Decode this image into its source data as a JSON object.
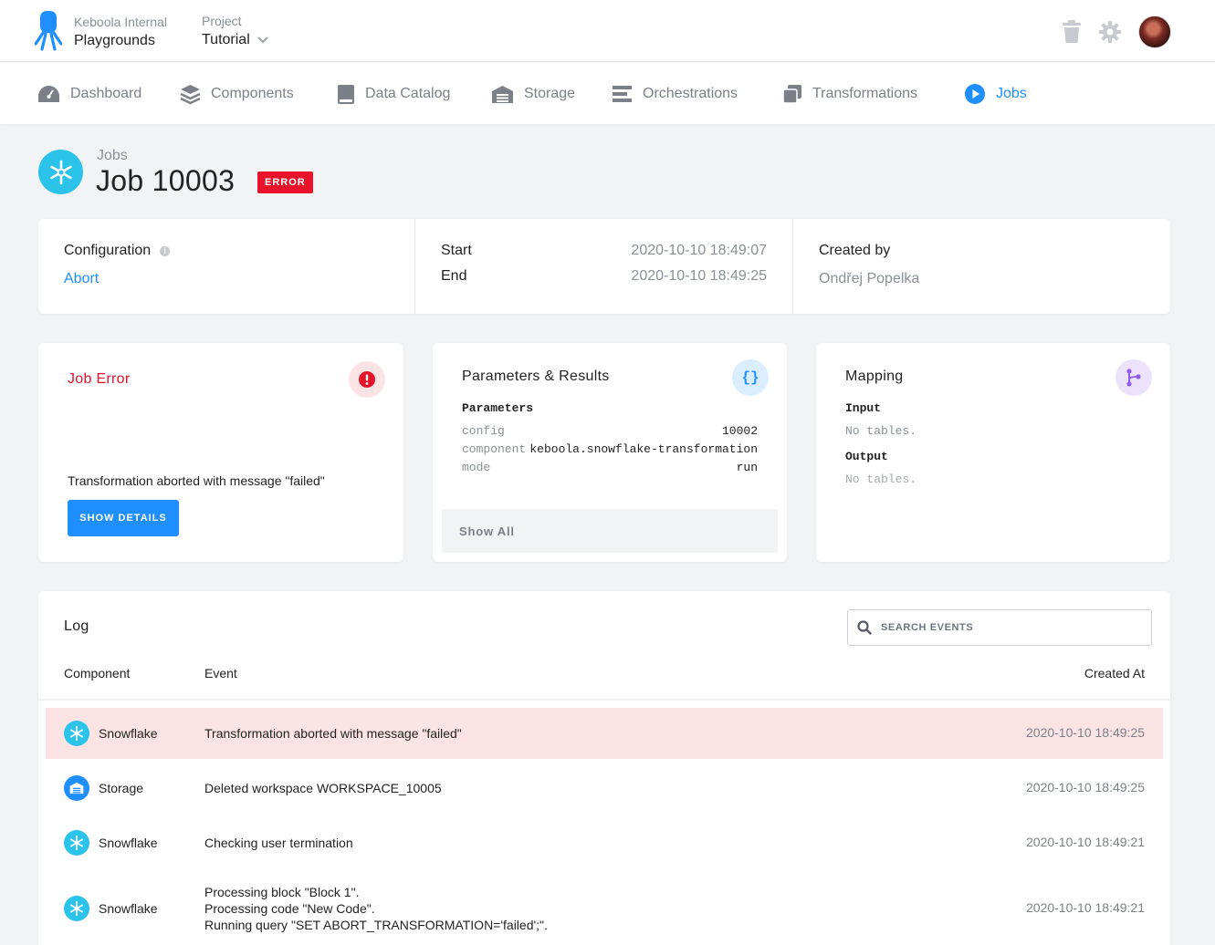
{
  "header": {
    "org_label": "Keboola Internal",
    "org_name": "Playgrounds",
    "project_label": "Project",
    "project_name": "Tutorial"
  },
  "nav": [
    {
      "label": "Dashboard",
      "icon": "gauge-icon"
    },
    {
      "label": "Components",
      "icon": "layers-icon"
    },
    {
      "label": "Data Catalog",
      "icon": "book-icon"
    },
    {
      "label": "Storage",
      "icon": "warehouse-icon"
    },
    {
      "label": "Orchestrations",
      "icon": "bars-icon"
    },
    {
      "label": "Transformations",
      "icon": "copy-icon"
    },
    {
      "label": "Jobs",
      "icon": "play-circle-icon",
      "active": true
    }
  ],
  "page": {
    "breadcrumb": "Jobs",
    "title": "Job 10003",
    "status": "ERROR"
  },
  "info": {
    "configuration_label": "Configuration",
    "configuration_value": "Abort",
    "start_label": "Start",
    "start_value": "2020-10-10 18:49:07",
    "end_label": "End",
    "end_value": "2020-10-10 18:49:25",
    "created_by_label": "Created by",
    "created_by_value": "Ondřej Popelka"
  },
  "job_error": {
    "title": "Job Error",
    "message": "Transformation aborted with message \"failed\"",
    "button": "SHOW DETAILS"
  },
  "params": {
    "title": "Parameters & Results",
    "section": "Parameters",
    "rows": [
      {
        "key": "config",
        "value": "10002"
      },
      {
        "key": "component",
        "value": "keboola.snowflake-transformation"
      },
      {
        "key": "mode",
        "value": "run"
      }
    ],
    "show_all": "Show All"
  },
  "mapping": {
    "title": "Mapping",
    "input_label": "Input",
    "input_value": "No tables.",
    "output_label": "Output",
    "output_value": "No tables."
  },
  "log": {
    "title": "Log",
    "search_placeholder": "SEARCH EVENTS",
    "columns": [
      "Component",
      "Event",
      "Created At"
    ],
    "rows": [
      {
        "component": "Snowflake",
        "event": "Transformation aborted with message \"failed\"",
        "created_at": "2020-10-10 18:49:25",
        "error": true
      },
      {
        "component": "Storage",
        "event": "Deleted workspace WORKSPACE_10005",
        "created_at": "2020-10-10 18:49:25"
      },
      {
        "component": "Snowflake",
        "event": "Checking user termination",
        "created_at": "2020-10-10 18:49:21"
      },
      {
        "component": "Snowflake",
        "event_lines": [
          "Processing block \"Block 1\".",
          "Processing code \"New Code\".",
          "Running query \"SET ABORT_TRANSFORMATION='failed';\"."
        ],
        "created_at": "2020-10-10 18:49:21"
      }
    ]
  },
  "colors": {
    "accent": "#1f8fff",
    "error": "#e8132a",
    "snowflake": "#2bc3ea"
  }
}
